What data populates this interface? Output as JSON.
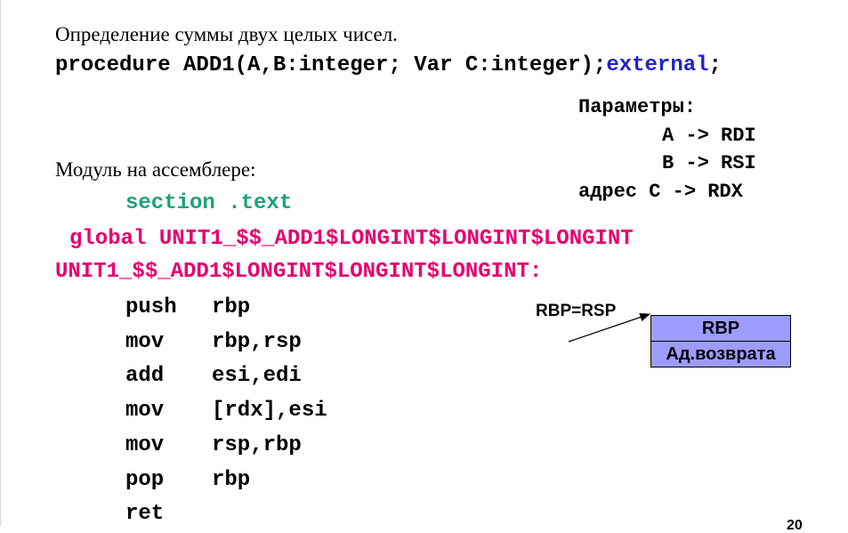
{
  "header": {
    "title": "Определение суммы двух целых чисел."
  },
  "signature": {
    "main": "procedure ADD1(A,B:integer; Var C:integer)",
    "semicolon1": ";",
    "external": "external",
    "semicolon2": ";"
  },
  "params": {
    "heading": "Параметры:",
    "lines": [
      "A -> RDI",
      "B -> RSI",
      "адрес C -> RDX"
    ]
  },
  "module": {
    "caption": "Модуль на ассемблере:",
    "section": "section .text",
    "global": "global UNIT1_$$_ADD1$LONGINT$LONGINT$LONGINT",
    "label": "UNIT1_$$_ADD1$LONGINT$LONGINT$LONGINT:"
  },
  "asm": [
    {
      "op": "push",
      "arg": "rbp"
    },
    {
      "op": "mov",
      "arg": "rbp,rsp"
    },
    {
      "op": "add",
      "arg": "esi,edi"
    },
    {
      "op": "mov",
      "arg": "[rdx],esi"
    },
    {
      "op": "mov",
      "arg": "rsp,rbp"
    },
    {
      "op": "pop",
      "arg": "rbp"
    },
    {
      "op": "ret",
      "arg": ""
    }
  ],
  "stack": {
    "pointer_label": "RBP=RSP",
    "cells": [
      "RBP",
      "Ад.возврата"
    ],
    "cell_color": "#9c9cff"
  },
  "page_number": "20",
  "colors": {
    "keyword_green": "#1aa37a",
    "keyword_blue": "#2222cc",
    "symbol_magenta": "#e6006e"
  }
}
